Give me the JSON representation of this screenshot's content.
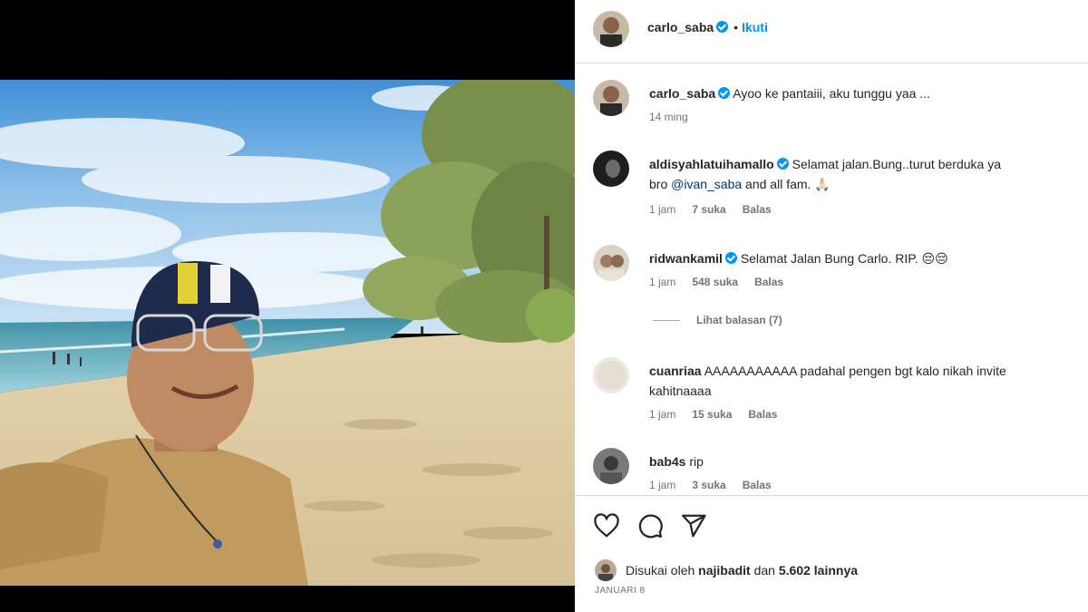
{
  "post": {
    "author": "carlo_saba",
    "follow_label": "Ikuti",
    "caption_author": "carlo_saba",
    "caption_text": "Ayoo ke pantaiii, aku tunggu yaa ...",
    "caption_time": "14 ming"
  },
  "comments": [
    {
      "username": "aldisyahlatuihamallo",
      "verified": true,
      "text": "Selamat jalan.Bung..turut berduka ya",
      "text_line2_prefix": "bro ",
      "mention": "@ivan_saba",
      "text_line2_suffix": " and all fam. 🙏🏻",
      "time": "1 jam",
      "likes": "7 suka",
      "reply": "Balas"
    },
    {
      "username": "ridwankamil",
      "verified": true,
      "text": "Selamat Jalan Bung Carlo. RIP. 😔😔",
      "time": "1 jam",
      "likes": "548 suka",
      "reply": "Balas",
      "view_replies": "Lihat balasan (7)"
    },
    {
      "username": "cuanriaa",
      "verified": false,
      "text": "AAAAAAAAAAA padahal pengen bgt kalo nikah invite",
      "text_line2": "kahitnaaaa",
      "time": "1 jam",
      "likes": "15 suka",
      "reply": "Balas"
    },
    {
      "username": "bab4s",
      "verified": false,
      "text": "rip",
      "time": "1 jam",
      "likes": "3 suka",
      "reply": "Balas"
    }
  ],
  "actions": {
    "like_icon": "heart-icon",
    "comment_icon": "comment-icon",
    "share_icon": "paper-plane-icon"
  },
  "likes_line": {
    "prefix": "Disukai oleh ",
    "user": "najibadit",
    "middle": " dan ",
    "count": "5.602 lainnya"
  },
  "date": "JANUARI 8",
  "colors": {
    "accent": "#0095f6",
    "text": "#262626",
    "muted": "#737373"
  }
}
